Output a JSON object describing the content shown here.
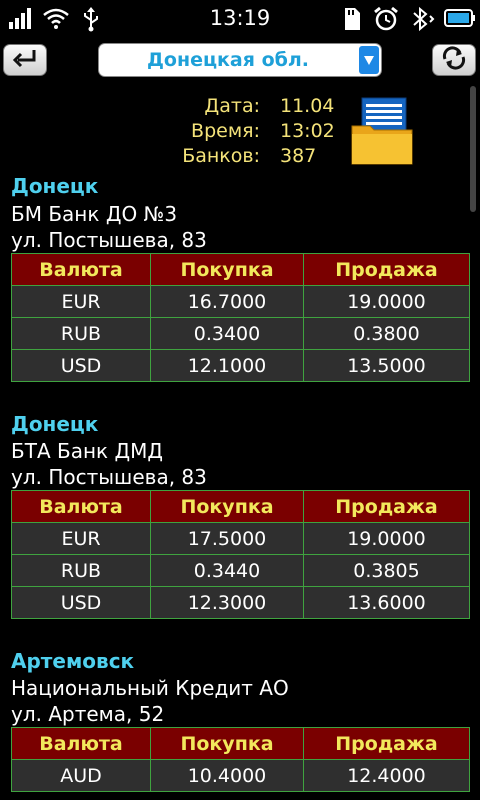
{
  "status_bar": {
    "time": "13:19",
    "icons": [
      "signal-icon",
      "wifi-icon",
      "usb-icon",
      "sd-card-icon",
      "alarm-icon",
      "bluetooth-icon",
      "battery-icon"
    ]
  },
  "toolbar": {
    "back_icon": "back-arrow-icon",
    "region": "Донецкая обл.",
    "refresh_icon": "refresh-icon"
  },
  "info": {
    "date_label": "Дата:",
    "date_value": "11.04",
    "time_label": "Время:",
    "time_value": "13:02",
    "banks_label": "Банков:",
    "banks_value": "387",
    "icon": "folder-document-icon"
  },
  "table_headers": {
    "currency": "Валюта",
    "buy": "Покупка",
    "sell": "Продажа"
  },
  "banks": [
    {
      "city": "Донецк",
      "name": "БМ Банк ДО №3",
      "address": "ул. Постышева, 83",
      "rates": [
        {
          "currency": "EUR",
          "buy": "16.7000",
          "sell": "19.0000"
        },
        {
          "currency": "RUB",
          "buy": "0.3400",
          "sell": "0.3800"
        },
        {
          "currency": "USD",
          "buy": "12.1000",
          "sell": "13.5000"
        }
      ]
    },
    {
      "city": "Донецк",
      "name": "БТА Банк ДМД",
      "address": "ул. Постышева, 83",
      "rates": [
        {
          "currency": "EUR",
          "buy": "17.5000",
          "sell": "19.0000"
        },
        {
          "currency": "RUB",
          "buy": "0.3440",
          "sell": "0.3805"
        },
        {
          "currency": "USD",
          "buy": "12.3000",
          "sell": "13.6000"
        }
      ]
    },
    {
      "city": "Артемовск",
      "name": "Национальный Кредит АО",
      "address": "ул. Артема, 52",
      "rates": [
        {
          "currency": "AUD",
          "buy": "10.4000",
          "sell": "12.4000"
        }
      ]
    }
  ],
  "colors": {
    "city": "#4fd0ee",
    "info_text": "#f4e37a",
    "header_bg": "#7a0000",
    "header_text": "#f2e85c",
    "cell_bg": "#2f2f2f",
    "grid": "#3fa33f",
    "dropdown_text": "#1ea0d8"
  }
}
